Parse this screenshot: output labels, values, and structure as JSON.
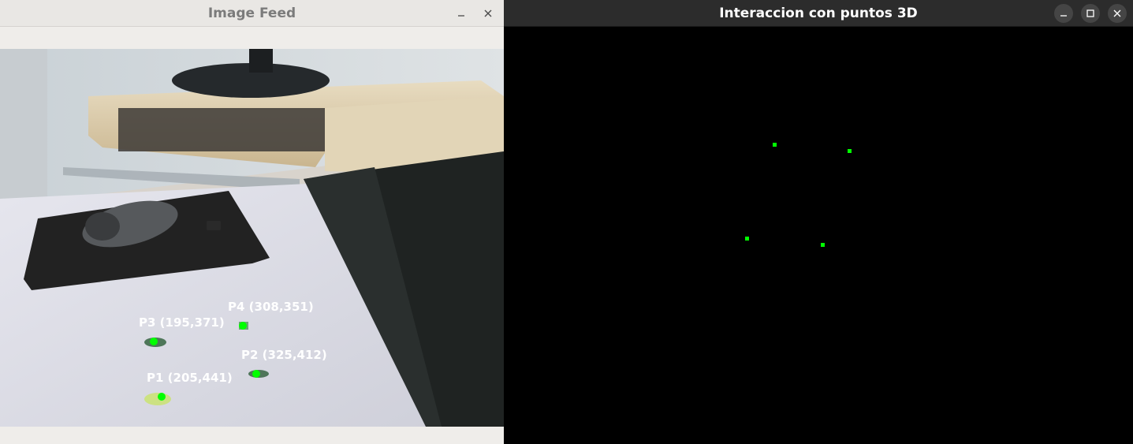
{
  "left_window": {
    "title": "Image Feed",
    "points": [
      {
        "label": "P1 (205,441)"
      },
      {
        "label": "P2 (325,412)"
      },
      {
        "label": "P3 (195,371)"
      },
      {
        "label": "P4 (308,351)"
      }
    ]
  },
  "right_window": {
    "title": "Interaccion con puntos 3D"
  },
  "colors": {
    "marker": "#00ff00",
    "label": "#ffffff"
  },
  "icons": {
    "minimize": "minimize-icon",
    "maximize": "maximize-icon",
    "close": "close-icon"
  }
}
